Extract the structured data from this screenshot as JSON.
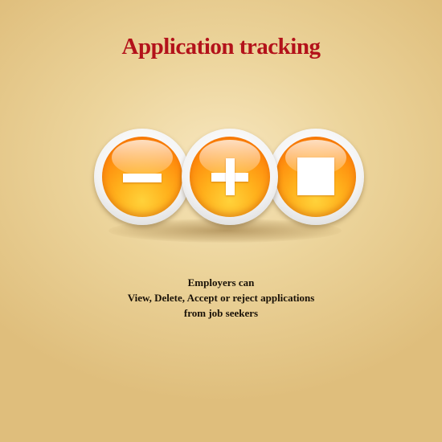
{
  "title": "Application tracking",
  "icons": {
    "minus_label": "minus-icon",
    "plus_label": "plus-icon",
    "stop_label": "stop-icon",
    "orb_color": "#ff8a0c",
    "title_color": "#b3121a"
  },
  "description": {
    "line1": "Employers can",
    "line2": "View, Delete, Accept or reject applications",
    "line3": "from job seekers"
  }
}
